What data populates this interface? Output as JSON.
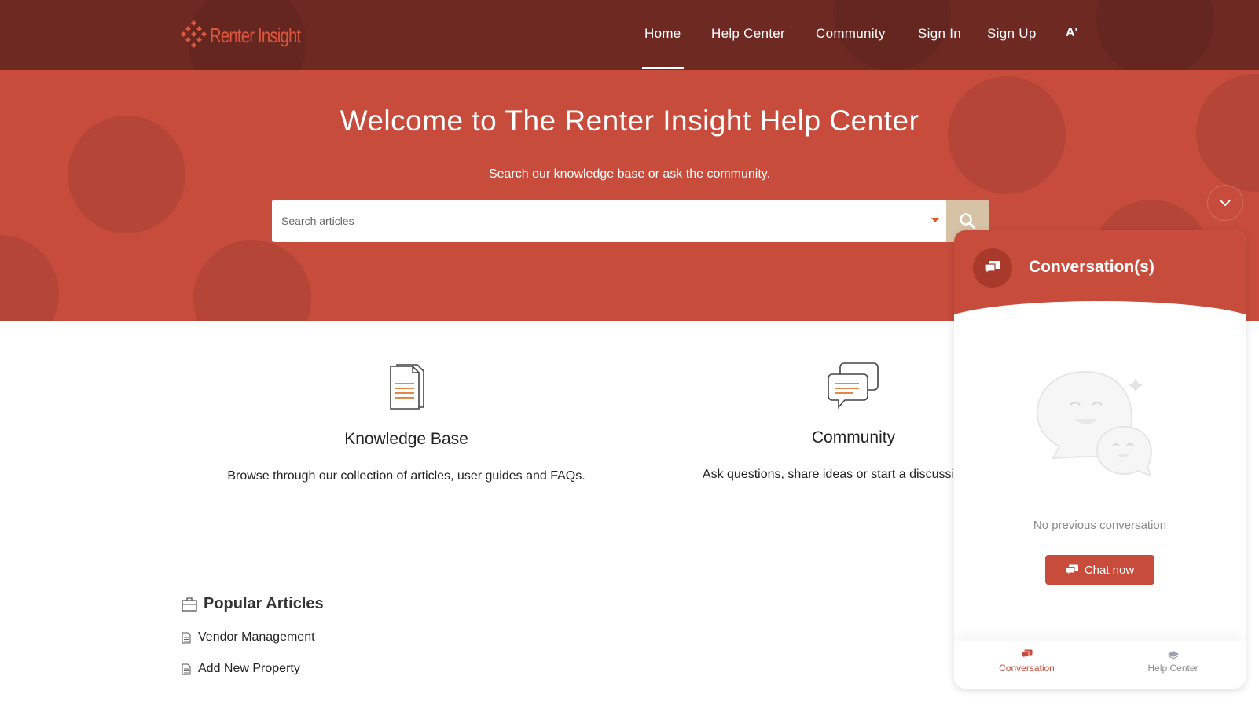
{
  "brand": {
    "name": "Renter Insight",
    "accent": "#c74c3c",
    "dark": "#6e2a22"
  },
  "nav": {
    "items": [
      "Home",
      "Help Center",
      "Community",
      "Sign In",
      "Sign Up"
    ],
    "active": "Home",
    "font_toggle": "A'"
  },
  "hero": {
    "title": "Welcome to The Renter Insight Help Center",
    "subtitle": "Search our knowledge base or ask the community.",
    "search_placeholder": "Search articles"
  },
  "cards": [
    {
      "title": "Knowledge Base",
      "description": "Browse through our collection of articles, user guides and FAQs.",
      "icon": "documents-icon"
    },
    {
      "title": "Community",
      "description": "Ask questions, share ideas or start a discussion with o",
      "icon": "chat-bubbles-icon"
    }
  ],
  "popular": {
    "heading": "Popular Articles",
    "articles": [
      "Vendor Management",
      "Add New Property"
    ]
  },
  "widget": {
    "title": "Conversation(s)",
    "empty_text": "No previous conversation",
    "chat_button": "Chat now",
    "tabs": [
      {
        "label": "Conversation",
        "active": true
      },
      {
        "label": "Help Center",
        "active": false
      }
    ]
  }
}
